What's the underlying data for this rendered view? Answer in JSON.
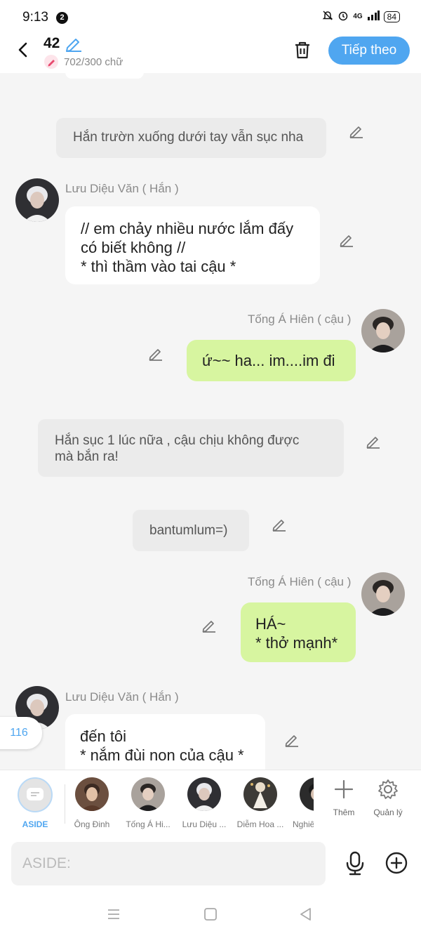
{
  "status": {
    "time": "9:13",
    "notifications": "2",
    "signal": "4G",
    "battery": "84"
  },
  "header": {
    "title_number": "42",
    "char_count": "702/300 chữ",
    "next_label": "Tiếp theo"
  },
  "messages": {
    "n1": "Hắn trườn xuống dưới tay vẫn sục nha",
    "m1_name": "Lưu Diệu Văn ( Hắn )",
    "m1_l1": "// em chảy nhiều nước lắm đấy",
    "m1_l2": "có biết không //",
    "m1_l3": "* thì thầm vào tai cậu *",
    "m2_name": "Tống Á Hiên ( cậu )",
    "m2_text": "ứ~~ ha... im....im đi",
    "n2_l1": "Hắn sục 1 lúc nữa , cậu chịu không được",
    "n2_l2": "mà bắn ra!",
    "n3": "bantumlum=)",
    "m3_name": "Tống Á Hiên ( cậu )",
    "m3_l1": "HÁ~",
    "m3_l2": "* thở mạnh*",
    "m4_name": "Lưu Diệu Văn ( Hắn )",
    "m4_l1": "đến tôi",
    "m4_l2": "* nắm đùi non của cậu *",
    "badge": "116"
  },
  "characters": {
    "aside": "ASIDE",
    "c1": "Ông Đinh",
    "c2": "Tống Á Hi...",
    "c3": "Lưu Diệu ...",
    "c4": "Diễm Hoa ...",
    "c5": "Nghiê",
    "add": "Thêm",
    "manage": "Quản lý"
  },
  "input": {
    "placeholder": "ASIDE:"
  },
  "colors": {
    "accent": "#4fa6f0",
    "bubble_green": "#d7f5a0",
    "narration": "#ebebeb"
  }
}
